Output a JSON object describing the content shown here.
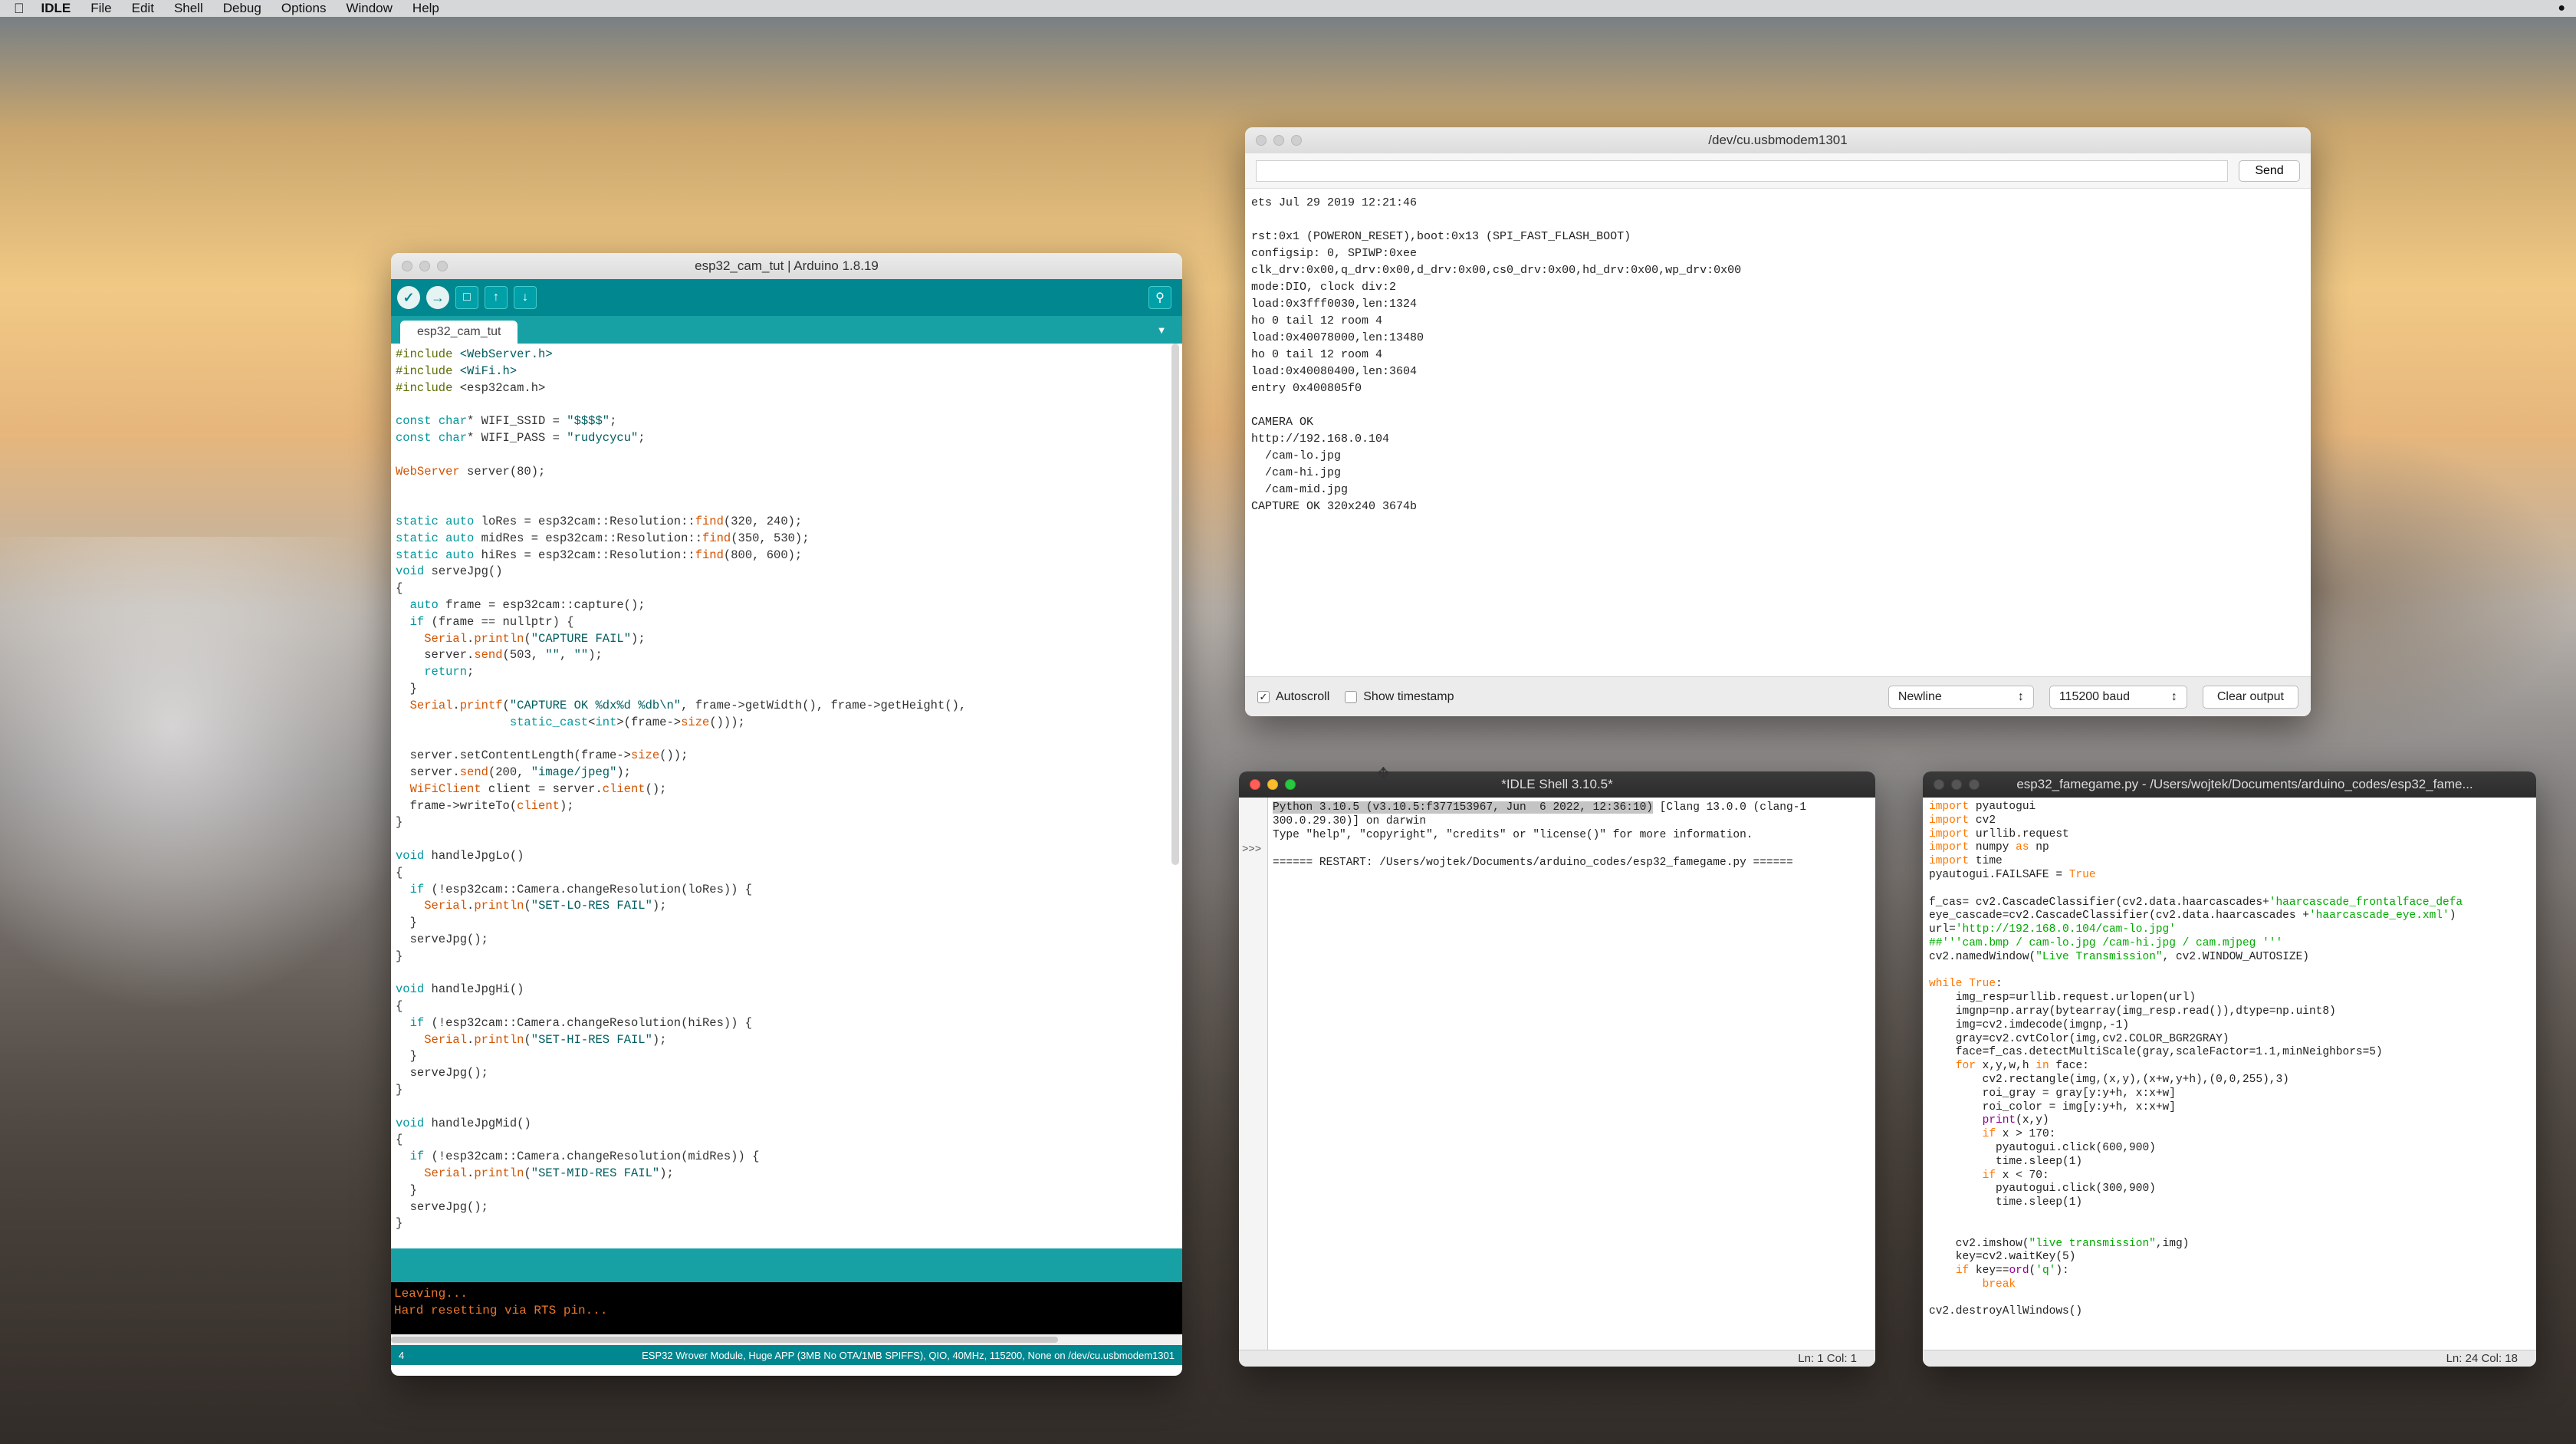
{
  "menubar": {
    "app_name": "IDLE",
    "items": [
      "File",
      "Edit",
      "Shell",
      "Debug",
      "Options",
      "Window",
      "Help"
    ]
  },
  "serial_monitor": {
    "title": "/dev/cu.usbmodem1301",
    "send_label": "Send",
    "output_lines": [
      "ets Jul 29 2019 12:21:46",
      "",
      "rst:0x1 (POWERON_RESET),boot:0x13 (SPI_FAST_FLASH_BOOT)",
      "configsip: 0, SPIWP:0xee",
      "clk_drv:0x00,q_drv:0x00,d_drv:0x00,cs0_drv:0x00,hd_drv:0x00,wp_drv:0x00",
      "mode:DIO, clock div:2",
      "load:0x3fff0030,len:1324",
      "ho 0 tail 12 room 4",
      "load:0x40078000,len:13480",
      "ho 0 tail 12 room 4",
      "load:0x40080400,len:3604",
      "entry 0x400805f0",
      "",
      "CAMERA OK",
      "http://192.168.0.104",
      "  /cam-lo.jpg",
      "  /cam-hi.jpg",
      "  /cam-mid.jpg",
      "CAPTURE OK 320x240 3674b"
    ],
    "autoscroll_label": "Autoscroll",
    "autoscroll_checked": "✓",
    "timestamp_label": "Show timestamp",
    "line_ending": "Newline",
    "baud": "115200 baud",
    "clear_label": "Clear output"
  },
  "arduino": {
    "title": "esp32_cam_tut | Arduino 1.8.19",
    "tab_label": "esp32_cam_tut",
    "console_lines": [
      "Leaving...",
      "Hard resetting via RTS pin..."
    ],
    "status_left": "4",
    "status_right": "ESP32 Wrover Module, Huge APP (3MB No OTA/1MB SPIFFS), QIO, 40MHz, 115200, None on /dev/cu.usbmodem1301"
  },
  "idle_shell": {
    "title": "*IDLE Shell 3.10.5*",
    "prompt": ">>>",
    "status": "Ln: 1   Col: 1",
    "line1_selected": "Python 3.10.5 (v3.10.5:f377153967, Jun  6 2022, 12:36:10)",
    "line1_rest": " [Clang 13.0.0 (clang-1",
    "line2": "300.0.29.30)] on darwin",
    "line3": "Type \"help\", \"copyright\", \"credits\" or \"license()\" for more information.",
    "line4": "",
    "line5": "====== RESTART: /Users/wojtek/Documents/arduino_codes/esp32_famegame.py ======"
  },
  "idle_editor": {
    "title": "esp32_famegame.py - /Users/wojtek/Documents/arduino_codes/esp32_fame...",
    "status": "Ln: 24   Col: 18"
  }
}
